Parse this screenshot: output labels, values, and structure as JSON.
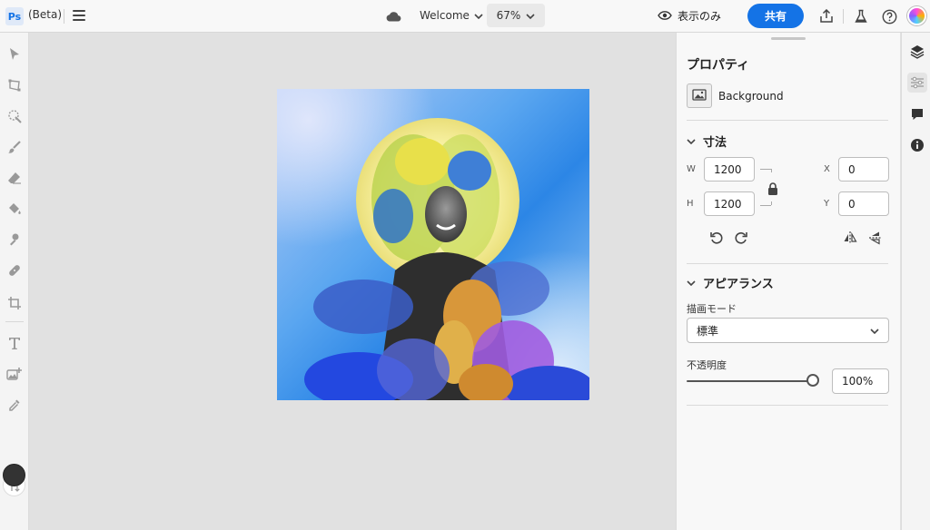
{
  "app": {
    "logo_text": "Ps",
    "beta_label": "(Beta)"
  },
  "header": {
    "document_name": "Welcome",
    "zoom_level": "67%",
    "view_only_label": "表示のみ",
    "share_label": "共有",
    "icons": [
      "menu-icon",
      "cloud-icon",
      "eye-icon",
      "upload-icon",
      "beaker-icon",
      "help-icon"
    ]
  },
  "tools": [
    "select-icon",
    "transform-icon",
    "quick-select-icon",
    "brush-icon",
    "eraser-icon",
    "paint-bucket-icon",
    "clone-stamp-icon",
    "healing-icon",
    "crop-icon",
    "type-icon",
    "add-image-icon",
    "eyedropper-icon",
    "swap-colors-icon"
  ],
  "colors": {
    "foreground": "#333333",
    "background": "#ffffff",
    "accent": "#1473e6"
  },
  "properties": {
    "title": "プロパティ",
    "layer_name": "Background",
    "dimensions": {
      "heading": "寸法",
      "w_label": "W",
      "w_value": "1200",
      "h_label": "H",
      "h_value": "1200",
      "x_label": "X",
      "x_value": "0",
      "y_label": "Y",
      "y_value": "0"
    },
    "appearance": {
      "heading": "アピアランス",
      "blend_mode_label": "描画モード",
      "blend_mode_value": "標準",
      "opacity_label": "不透明度",
      "opacity_value": "100%",
      "opacity_fraction": 1.0
    }
  },
  "rail": [
    "layers-icon",
    "adjustments-icon",
    "comments-icon",
    "info-icon"
  ]
}
